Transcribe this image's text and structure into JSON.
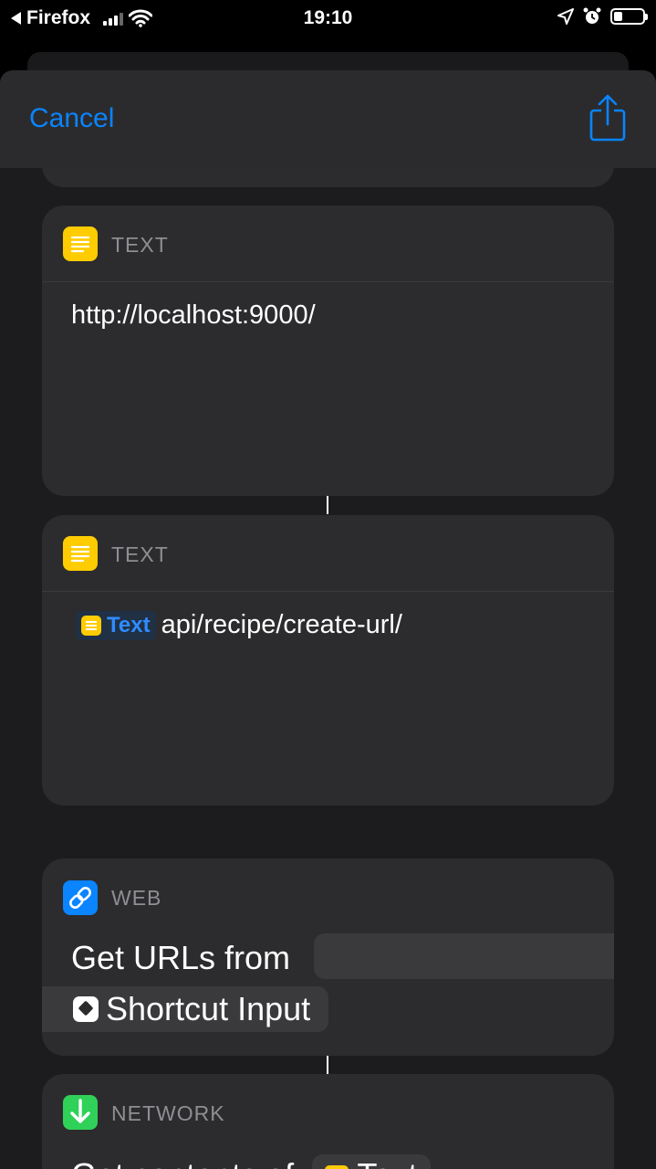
{
  "status_bar": {
    "back_app": "Firefox",
    "time": "19:10"
  },
  "nav": {
    "cancel_label": "Cancel"
  },
  "actions": [
    {
      "category": "TEXT",
      "content": "http://localhost:9000/"
    },
    {
      "category": "TEXT",
      "variable": "Text",
      "content": "api/recipe/create-url/"
    },
    {
      "category": "WEB",
      "content": "Get URLs from",
      "input": "Shortcut Input"
    },
    {
      "category": "NETWORK",
      "content": "Get contents of",
      "variable": "Text"
    }
  ],
  "colors": {
    "accent": "#0a84ff",
    "text_icon": "#ffcc00",
    "web_icon": "#0a84ff",
    "network_icon": "#30d158"
  }
}
